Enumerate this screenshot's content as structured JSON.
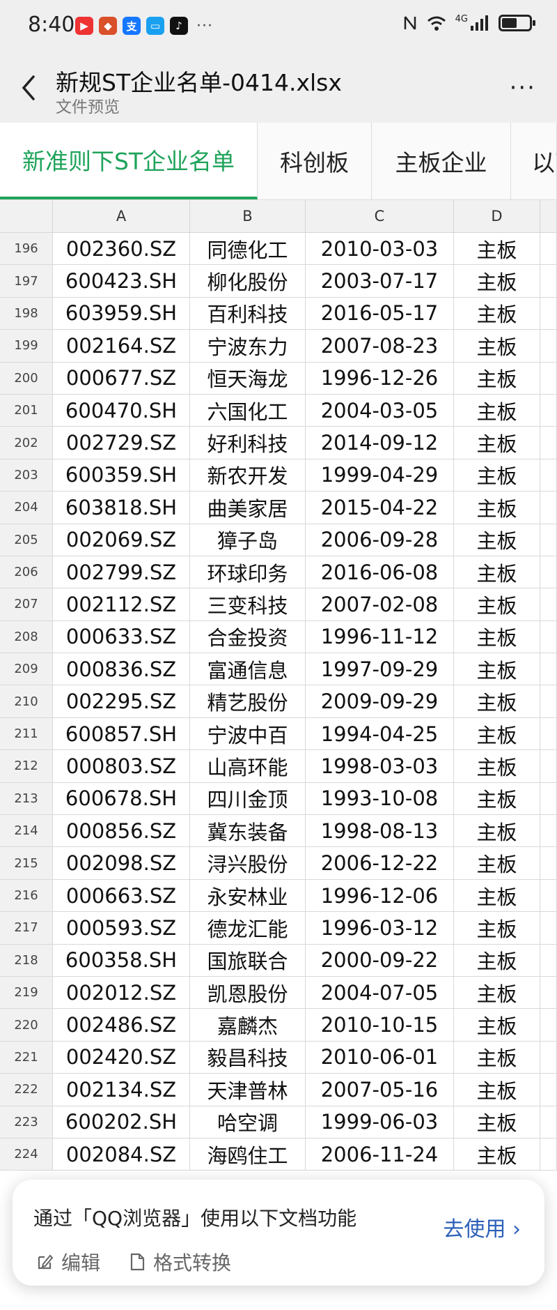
{
  "status": {
    "time": "8:40",
    "network": "4G",
    "battery_level": 0.55
  },
  "header": {
    "title": "新规ST企业名单-0414.xlsx",
    "subtitle": "文件预览",
    "menu": "···"
  },
  "tabs": [
    "新准则下ST企业名单",
    "科创板",
    "主板企业",
    "以下"
  ],
  "columns": [
    "A",
    "B",
    "C",
    "D"
  ],
  "rows": [
    {
      "n": "196",
      "a": "002360.SZ",
      "b": "同德化工",
      "c": "2010-03-03",
      "d": "主板"
    },
    {
      "n": "197",
      "a": "600423.SH",
      "b": "柳化股份",
      "c": "2003-07-17",
      "d": "主板"
    },
    {
      "n": "198",
      "a": "603959.SH",
      "b": "百利科技",
      "c": "2016-05-17",
      "d": "主板"
    },
    {
      "n": "199",
      "a": "002164.SZ",
      "b": "宁波东力",
      "c": "2007-08-23",
      "d": "主板"
    },
    {
      "n": "200",
      "a": "000677.SZ",
      "b": "恒天海龙",
      "c": "1996-12-26",
      "d": "主板"
    },
    {
      "n": "201",
      "a": "600470.SH",
      "b": "六国化工",
      "c": "2004-03-05",
      "d": "主板"
    },
    {
      "n": "202",
      "a": "002729.SZ",
      "b": "好利科技",
      "c": "2014-09-12",
      "d": "主板"
    },
    {
      "n": "203",
      "a": "600359.SH",
      "b": "新农开发",
      "c": "1999-04-29",
      "d": "主板"
    },
    {
      "n": "204",
      "a": "603818.SH",
      "b": "曲美家居",
      "c": "2015-04-22",
      "d": "主板"
    },
    {
      "n": "205",
      "a": "002069.SZ",
      "b": "獐子岛",
      "c": "2006-09-28",
      "d": "主板"
    },
    {
      "n": "206",
      "a": "002799.SZ",
      "b": "环球印务",
      "c": "2016-06-08",
      "d": "主板"
    },
    {
      "n": "207",
      "a": "002112.SZ",
      "b": "三变科技",
      "c": "2007-02-08",
      "d": "主板"
    },
    {
      "n": "208",
      "a": "000633.SZ",
      "b": "合金投资",
      "c": "1996-11-12",
      "d": "主板"
    },
    {
      "n": "209",
      "a": "000836.SZ",
      "b": "富通信息",
      "c": "1997-09-29",
      "d": "主板"
    },
    {
      "n": "210",
      "a": "002295.SZ",
      "b": "精艺股份",
      "c": "2009-09-29",
      "d": "主板"
    },
    {
      "n": "211",
      "a": "600857.SH",
      "b": "宁波中百",
      "c": "1994-04-25",
      "d": "主板"
    },
    {
      "n": "212",
      "a": "000803.SZ",
      "b": "山高环能",
      "c": "1998-03-03",
      "d": "主板"
    },
    {
      "n": "213",
      "a": "600678.SH",
      "b": "四川金顶",
      "c": "1993-10-08",
      "d": "主板"
    },
    {
      "n": "214",
      "a": "000856.SZ",
      "b": "冀东装备",
      "c": "1998-08-13",
      "d": "主板"
    },
    {
      "n": "215",
      "a": "002098.SZ",
      "b": "浔兴股份",
      "c": "2006-12-22",
      "d": "主板"
    },
    {
      "n": "216",
      "a": "000663.SZ",
      "b": "永安林业",
      "c": "1996-12-06",
      "d": "主板"
    },
    {
      "n": "217",
      "a": "000593.SZ",
      "b": "德龙汇能",
      "c": "1996-03-12",
      "d": "主板"
    },
    {
      "n": "218",
      "a": "600358.SH",
      "b": "国旅联合",
      "c": "2000-09-22",
      "d": "主板"
    },
    {
      "n": "219",
      "a": "002012.SZ",
      "b": "凯恩股份",
      "c": "2004-07-05",
      "d": "主板"
    },
    {
      "n": "220",
      "a": "002486.SZ",
      "b": "嘉麟杰",
      "c": "2010-10-15",
      "d": "主板"
    },
    {
      "n": "221",
      "a": "002420.SZ",
      "b": "毅昌科技",
      "c": "2010-06-01",
      "d": "主板"
    },
    {
      "n": "222",
      "a": "002134.SZ",
      "b": "天津普林",
      "c": "2007-05-16",
      "d": "主板"
    },
    {
      "n": "223",
      "a": "600202.SH",
      "b": "哈空调",
      "c": "1999-06-03",
      "d": "主板"
    },
    {
      "n": "224",
      "a": "002084.SZ",
      "b": "海鸥住工",
      "c": "2006-11-24",
      "d": "主板"
    }
  ],
  "banner": {
    "title": "通过「QQ浏览器」使用以下文档功能",
    "cta": "去使用 ›",
    "edit": "编辑",
    "convert": "格式转换"
  },
  "colors": {
    "accent_green": "#1fa35a",
    "link_blue": "#2b5fb8"
  }
}
